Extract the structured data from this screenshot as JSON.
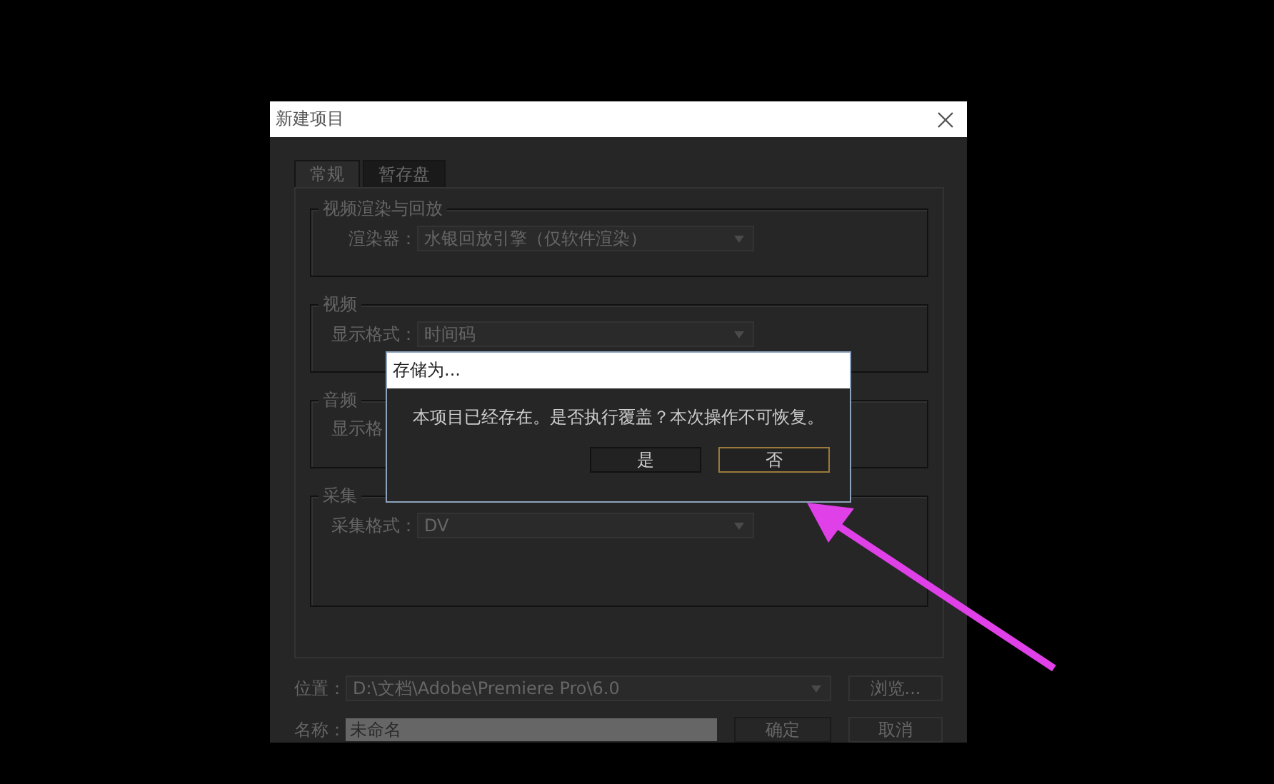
{
  "window": {
    "title": "新建项目",
    "disabled": true
  },
  "tabs": [
    {
      "label": "常规",
      "selected": true
    },
    {
      "label": "暂存盘",
      "selected": false
    }
  ],
  "groups": [
    {
      "title": "视频渲染与回放",
      "rows": [
        {
          "label": "渲染器：",
          "value": "水银回放引擎（仅软件渲染）"
        }
      ]
    },
    {
      "title": "视频",
      "rows": [
        {
          "label": "显示格式：",
          "value": "时间码"
        }
      ]
    },
    {
      "title": "音频",
      "rows": [
        {
          "label": "显示格",
          "value": ""
        }
      ]
    },
    {
      "title": "采集",
      "rows": [
        {
          "label": "采集格式：",
          "value": "DV"
        }
      ]
    }
  ],
  "location": {
    "label": "位置：",
    "value": "D:\\文档\\Adobe\\Premiere Pro\\6.0",
    "button": "浏览..."
  },
  "name": {
    "label": "名称：",
    "placeholder": "未命名"
  },
  "buttons": [
    {
      "label": "确定"
    },
    {
      "label": "取消"
    }
  ],
  "alert": {
    "title": "存储为...",
    "message": "本项目已经存在。是否执行覆盖？本次操作不可恢复。",
    "buttons": [
      {
        "label": "是",
        "selected": false
      },
      {
        "label": "否",
        "selected": true
      }
    ]
  },
  "annotation": {
    "color": "#e040e8"
  }
}
